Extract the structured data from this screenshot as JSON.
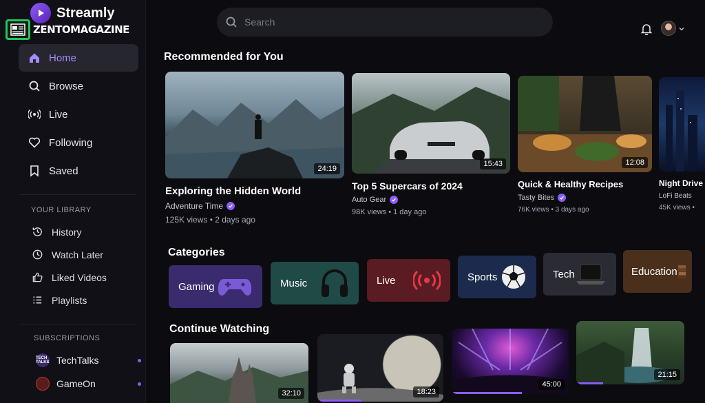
{
  "app": {
    "name": "Streamly",
    "watermark": "ZENTOMAGAZINE"
  },
  "search": {
    "placeholder": "Search"
  },
  "sidebar": {
    "nav": [
      {
        "label": "Home",
        "icon": "home-icon",
        "active": true
      },
      {
        "label": "Browse",
        "icon": "search-icon"
      },
      {
        "label": "Live",
        "icon": "broadcast-icon"
      },
      {
        "label": "Following",
        "icon": "heart-icon"
      },
      {
        "label": "Saved",
        "icon": "bookmark-icon"
      }
    ],
    "library_title": "YOUR LIBRARY",
    "library": [
      {
        "label": "History",
        "icon": "history-icon"
      },
      {
        "label": "Watch Later",
        "icon": "clock-icon"
      },
      {
        "label": "Liked Videos",
        "icon": "thumbs-up-icon"
      },
      {
        "label": "Playlists",
        "icon": "playlist-icon"
      }
    ],
    "subscriptions_title": "SUBSCRIPTIONS",
    "subscriptions": [
      {
        "label": "TechTalks",
        "avatar_text": "TECH TALKS"
      },
      {
        "label": "GameOn",
        "avatar_text": ""
      }
    ]
  },
  "recommended": {
    "title": "Recommended for You",
    "videos": [
      {
        "title": "Exploring the Hidden World",
        "channel": "Adventure Time",
        "views": "125K views",
        "age": "2 days ago",
        "duration": "24:19"
      },
      {
        "title": "Top 5 Supercars of 2024",
        "channel": "Auto Gear",
        "views": "98K views",
        "age": "1 day ago",
        "duration": "15:43"
      },
      {
        "title": "Quick & Healthy Recipes",
        "channel": "Tasty Bites",
        "views": "76K views",
        "age": "3 days ago",
        "duration": "12:08"
      },
      {
        "title": "Night Drive in T",
        "channel": "LoFi Beats",
        "views": "45K views",
        "age": "",
        "duration": ""
      }
    ]
  },
  "categories": {
    "title": "Categories",
    "items": [
      {
        "label": "Gaming",
        "icon": "gamepad-icon",
        "color": "#3a2a6e"
      },
      {
        "label": "Music",
        "icon": "headphones-icon",
        "color": "#1f4a46"
      },
      {
        "label": "Live",
        "icon": "live-signal-icon",
        "color": "#5a1b22"
      },
      {
        "label": "Sports",
        "icon": "soccer-ball-icon",
        "color": "#1c2a4e"
      },
      {
        "label": "Tech",
        "icon": "laptop-icon",
        "color": "#2a2b33"
      },
      {
        "label": "Education",
        "icon": "books-icon",
        "color": "#4a2f1c"
      }
    ]
  },
  "continue": {
    "title": "Continue Watching",
    "videos": [
      {
        "duration": "32:10",
        "progress": 0.0
      },
      {
        "duration": "18:23",
        "progress": 0.35
      },
      {
        "duration": "45:00",
        "progress": 0.6
      },
      {
        "duration": "21:15",
        "progress": 0.25
      }
    ]
  },
  "colors": {
    "accent": "#8b5cf6",
    "background": "#0b0b10"
  }
}
